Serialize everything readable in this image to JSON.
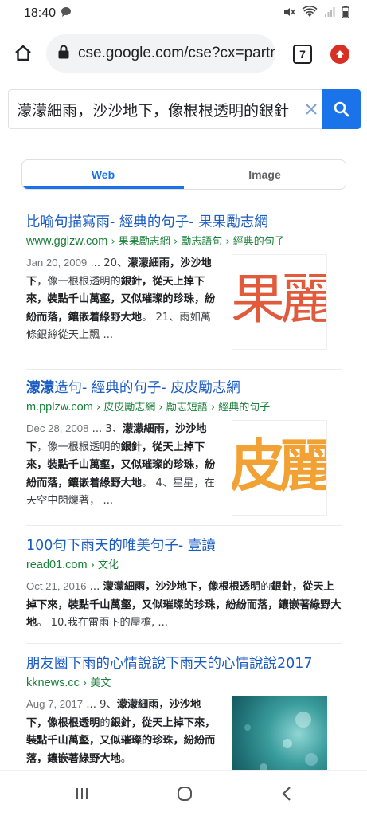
{
  "status_bar": {
    "time": "18:40"
  },
  "browser": {
    "url": "cse.google.com/cse?cx=partne",
    "tab_count": "7"
  },
  "search": {
    "query": "濛濛細雨，沙沙地下，像根根透明的銀針"
  },
  "tabs": [
    {
      "label": "Web",
      "active": true
    },
    {
      "label": "Image",
      "active": false
    }
  ],
  "results": [
    {
      "title": "比喻句描寫雨- 經典的句子- 果果勵志網",
      "domain": "www.gglzw.com",
      "path": " › 果果勵志網 › 勵志語句 › 經典的句子",
      "date": "Jan 20, 2009",
      "snippet_pre": " ... 20、",
      "snippet_bold": "濛濛細雨，沙沙地下",
      "snippet_mid": "，像一根根透明的",
      "snippet_bold2": "銀針，從天上掉下來，裝點千山萬壑，又似璀璨的珍珠，紛紛而落，鑲嵌着綠野大地",
      "snippet_post": "。 21、雨如萬條銀絲從天上飄 ...",
      "thumb_text": "果麗",
      "thumb_color": "#e0583a"
    },
    {
      "title_bold": "濛濛",
      "title": "造句- 經典的句子- 皮皮勵志網",
      "domain": "m.pplzw.com",
      "path": " › 皮皮勵志網 › 勵志短語 › 經典的句子",
      "date": "Dec 28, 2008",
      "snippet_pre": " ... 3、",
      "snippet_bold": "濛濛細雨，沙沙地下",
      "snippet_mid": "，像一根根透明的",
      "snippet_bold2": "銀針，從天上掉下來，裝點千山萬壑，又似璀璨的珍珠，紛紛而落，鑲嵌着綠野大地",
      "snippet_post": "。 4、星星，在天空中閃爍著， ...",
      "thumb_text": "皮麗",
      "thumb_color": "#f0a030"
    },
    {
      "title": "100句下雨天的唯美句子- 壹讀",
      "domain": "read01.com",
      "path": " › 文化",
      "date": "Oct 21, 2016",
      "snippet_pre": " ... ",
      "snippet_bold": "濛濛細雨，沙沙地下，像根根透明",
      "snippet_mid": "的",
      "snippet_bold2": "銀針，從天上掉下來，裝點千山萬壑，又似璀璨的珍珠，紛紛而落，鑲嵌著綠野大地",
      "snippet_post": "。 10.我在雷雨下的屋檐, ..."
    },
    {
      "title": "朋友圈下雨的心情說說下雨天的心情說說2017",
      "domain": "kknews.cc",
      "path": " › 美文",
      "date": "Aug 7, 2017",
      "snippet_pre": " ... 9、",
      "snippet_bold": "濛濛細雨，沙沙地下，像根根透明",
      "snippet_mid": "的",
      "snippet_bold2": "銀針，從天上掉下來，裝點千山萬壑，又似璀璨的珍珠，紛紛而落，鑲嵌著綠野大地",
      "snippet_post": "。",
      "thumb_color": "#2a8a8a"
    }
  ],
  "colors": {
    "accent": "#1a73e8",
    "link": "#1a5bc4",
    "url_green": "#188038",
    "update_red": "#d93025"
  }
}
